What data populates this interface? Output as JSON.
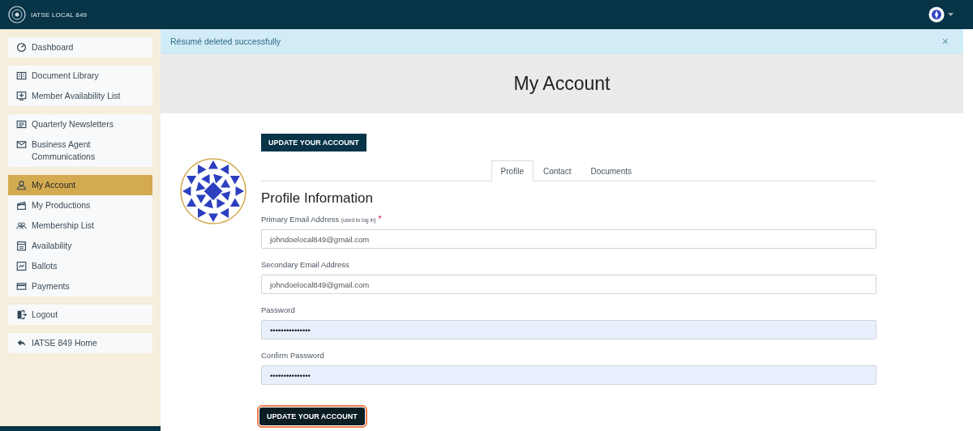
{
  "topbar": {
    "brand": "IATSE LOCAL 849"
  },
  "sidebar": {
    "groups": [
      {
        "items": [
          {
            "label": "Dashboard",
            "selected": false
          }
        ]
      },
      {
        "items": [
          {
            "label": "Document Library",
            "selected": false
          },
          {
            "label": "Member Availability List",
            "selected": false
          }
        ]
      },
      {
        "items": [
          {
            "label": "Quarterly Newsletters",
            "selected": false
          },
          {
            "label": "Business Agent Communications",
            "selected": false
          }
        ]
      },
      {
        "items": [
          {
            "label": "My Account",
            "selected": true
          },
          {
            "label": "My Productions",
            "selected": false
          },
          {
            "label": "Membership List",
            "selected": false
          },
          {
            "label": "Availability",
            "selected": false
          },
          {
            "label": "Ballots",
            "selected": false
          },
          {
            "label": "Payments",
            "selected": false
          }
        ]
      },
      {
        "items": [
          {
            "label": "Logout",
            "selected": false
          }
        ]
      },
      {
        "items": [
          {
            "label": "IATSE 849 Home",
            "selected": false
          }
        ]
      }
    ]
  },
  "alert": {
    "message": "Résumé deleted successfully",
    "close": "×"
  },
  "page_title": "My Account",
  "top_button": {
    "label": "UPDATE YOUR ACCOUNT"
  },
  "tabs": [
    {
      "label": "Profile",
      "selected": true
    },
    {
      "label": "Contact",
      "selected": false
    },
    {
      "label": "Documents",
      "selected": false
    }
  ],
  "section_title": "Profile Information",
  "fields": [
    {
      "label": "Primary Email Address",
      "note": "(used to log in)",
      "required_mark": "*",
      "value": "johndoelocal849@gmail.com",
      "kind": "text"
    },
    {
      "label": "Secondary Email Address",
      "value": "johndoelocal849@gmail.com",
      "kind": "text"
    },
    {
      "label": "Password",
      "value": "•••••••••••••••",
      "kind": "password"
    },
    {
      "label": "Confirm Password",
      "value": "•••••••••••••••",
      "kind": "password"
    }
  ],
  "bottom_button": {
    "label": "UPDATE YOUR ACCOUNT",
    "focused": true
  }
}
